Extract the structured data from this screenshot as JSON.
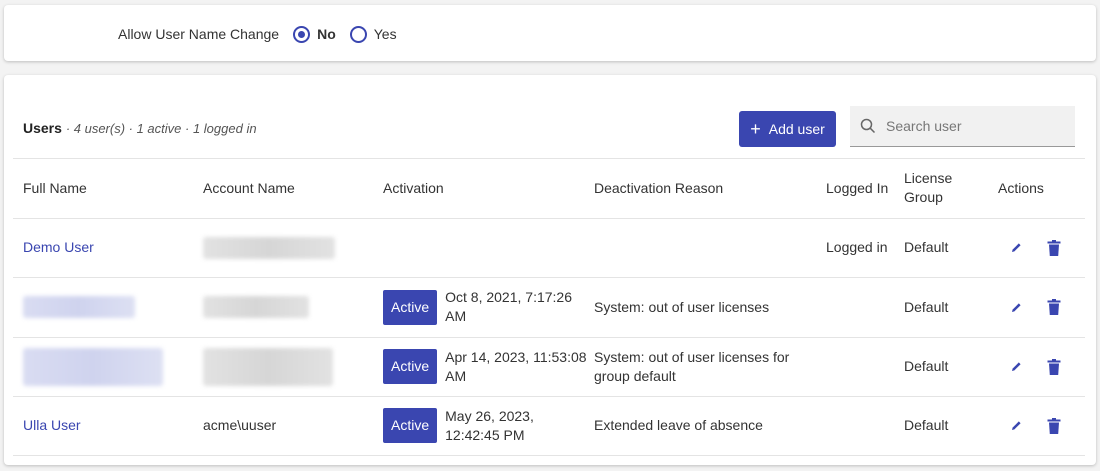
{
  "settings": {
    "allow_username_change_label": "Allow User Name Change",
    "options": [
      {
        "label": "No",
        "checked": true
      },
      {
        "label": "Yes",
        "checked": false
      }
    ]
  },
  "users": {
    "title": "Users",
    "summary": "· 4 user(s) · 1 active · 1 logged in",
    "add_button_label": "Add user",
    "search_placeholder": "Search user"
  },
  "table": {
    "headers": {
      "full_name": "Full Name",
      "account_name": "Account Name",
      "activation": "Activation",
      "deactivation_reason": "Deactivation Reason",
      "logged_in": "Logged In",
      "license_group": "License Group",
      "actions": "Actions"
    },
    "rows": [
      {
        "full_name": "Demo User",
        "account_name": "",
        "status": "",
        "activation_date": "",
        "deactivation_reason": "",
        "logged_in": "Logged in",
        "license_group": "Default"
      },
      {
        "full_name": "",
        "account_name": "",
        "status": "Active",
        "activation_date": "Oct 8, 2021, 7:17:26 AM",
        "deactivation_reason": "System: out of user licenses",
        "logged_in": "",
        "license_group": "Default"
      },
      {
        "full_name": "",
        "account_name": "",
        "status": "Active",
        "activation_date": "Apr 14, 2023, 11:53:08 AM",
        "deactivation_reason": "System: out of user licenses for group default",
        "logged_in": "",
        "license_group": "Default"
      },
      {
        "full_name": "Ulla User",
        "account_name": "acme\\uuser",
        "status": "Active",
        "activation_date": "May 26, 2023, 12:42:45 PM",
        "deactivation_reason": "Extended leave of absence",
        "logged_in": "",
        "license_group": "Default"
      }
    ]
  },
  "colors": {
    "accent": "#3a46b0",
    "background": "#f3f3f3",
    "card": "#ffffff"
  },
  "icons": {
    "search": "search-icon",
    "add": "plus-icon",
    "edit": "pencil-icon",
    "delete": "trash-icon"
  }
}
